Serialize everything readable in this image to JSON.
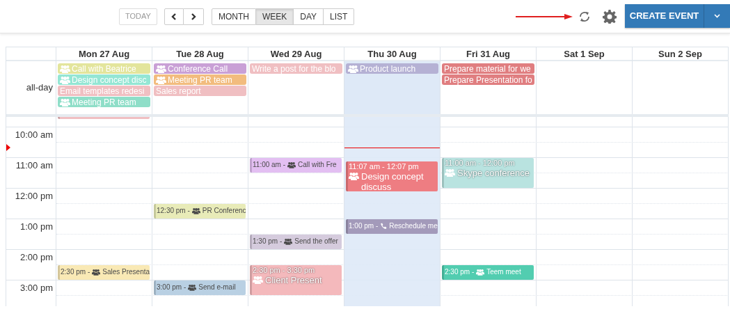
{
  "toolbar": {
    "today_button": {
      "label": "TODAY",
      "disabled": true
    },
    "views": [
      {
        "label": "MONTH",
        "selected": false
      },
      {
        "label": "WEEK",
        "selected": true
      },
      {
        "label": "DAY",
        "selected": false
      },
      {
        "label": "LIST",
        "selected": false
      }
    ],
    "create_button": "CREATE EVENT"
  },
  "calendar": {
    "allday_label": "all-day",
    "now_indicator": true,
    "time_labels": [
      "10:00 am",
      "11:00 am",
      "12:00 pm",
      "1:00 pm",
      "2:00 pm",
      "3:00 pm"
    ],
    "days": [
      {
        "label": "Mon 27 Aug",
        "today": false,
        "allday": [
          {
            "title": "Call with Beatrice",
            "kind": "meeting",
            "color": "#e3e59c"
          },
          {
            "title": "Design concept disc",
            "kind": "meeting",
            "color": "#94e6d4"
          },
          {
            "title": "Email templates redesi",
            "kind": "task",
            "color": "#f0bfc2"
          },
          {
            "title": "Meeting PR team",
            "kind": "meeting",
            "color": "#8fdec8"
          }
        ],
        "events": [
          {
            "kind": "continued",
            "color": "#f0bfc2"
          },
          {
            "time": "2:30 pm -",
            "title": "Sales Presenta",
            "kind": "meeting",
            "color": "#f9e9b5"
          }
        ]
      },
      {
        "label": "Tue 28 Aug",
        "today": false,
        "allday": [
          {
            "title": "Conference Call",
            "kind": "meeting",
            "color": "#c9a0d6"
          },
          {
            "title": "Meeting PR team",
            "kind": "meeting",
            "color": "#f2bc7e"
          },
          {
            "title": "Sales report",
            "kind": "task",
            "color": "#f0bfc2"
          }
        ],
        "events": [
          {
            "time": "12:30 pm -",
            "title": "PR Conferenc",
            "kind": "meeting",
            "color": "#e8ebb8"
          },
          {
            "time": "3:00 pm -",
            "title": "Send e-mail",
            "kind": "meeting",
            "color": "#b9d0e3"
          }
        ]
      },
      {
        "label": "Wed 29 Aug",
        "today": false,
        "allday": [
          {
            "title": "Write a post for the blo",
            "kind": "task",
            "color": "#f0bfc2"
          }
        ],
        "events": [
          {
            "time": "11:00 am -",
            "title": "Call with Fre",
            "kind": "meeting",
            "color": "#e3bff2"
          },
          {
            "time": "1:30 pm -",
            "title": "Send the offer",
            "kind": "meeting",
            "color": "#d5cbdd"
          },
          {
            "time": "2:30 pm - 3:30 pm",
            "title": "Client Present",
            "kind": "meeting",
            "color": "#f4b9bc"
          }
        ]
      },
      {
        "label": "Thu 30 Aug",
        "today": true,
        "allday": [
          {
            "title": "Product launch",
            "kind": "meeting",
            "color": "#b5b1d4"
          }
        ],
        "events": [
          {
            "time": "11:07 am - 12:07 pm",
            "title": "Design concept discuss",
            "kind": "meeting",
            "color": "#ee7d82"
          },
          {
            "time": "1:00 pm -",
            "title": "Reschedule me",
            "kind": "call",
            "color": "#a39aba"
          }
        ]
      },
      {
        "label": "Fri 31 Aug",
        "today": false,
        "allday": [
          {
            "title": "Prepare material for we",
            "kind": "task",
            "color": "#e07e80"
          },
          {
            "title": "Prepare Presentation fo",
            "kind": "task",
            "color": "#e07e80"
          }
        ],
        "events": [
          {
            "time": "11:00 am - 12:00 pm",
            "title": "Skype conference",
            "kind": "meeting",
            "color": "#b9e3e0"
          },
          {
            "time": "2:30 pm -",
            "title": "Teem meet",
            "kind": "meeting",
            "color": "#52cdb0"
          }
        ]
      },
      {
        "label": "Sat 1 Sep",
        "today": false
      },
      {
        "label": "Sun 2 Sep",
        "today": false
      }
    ]
  }
}
